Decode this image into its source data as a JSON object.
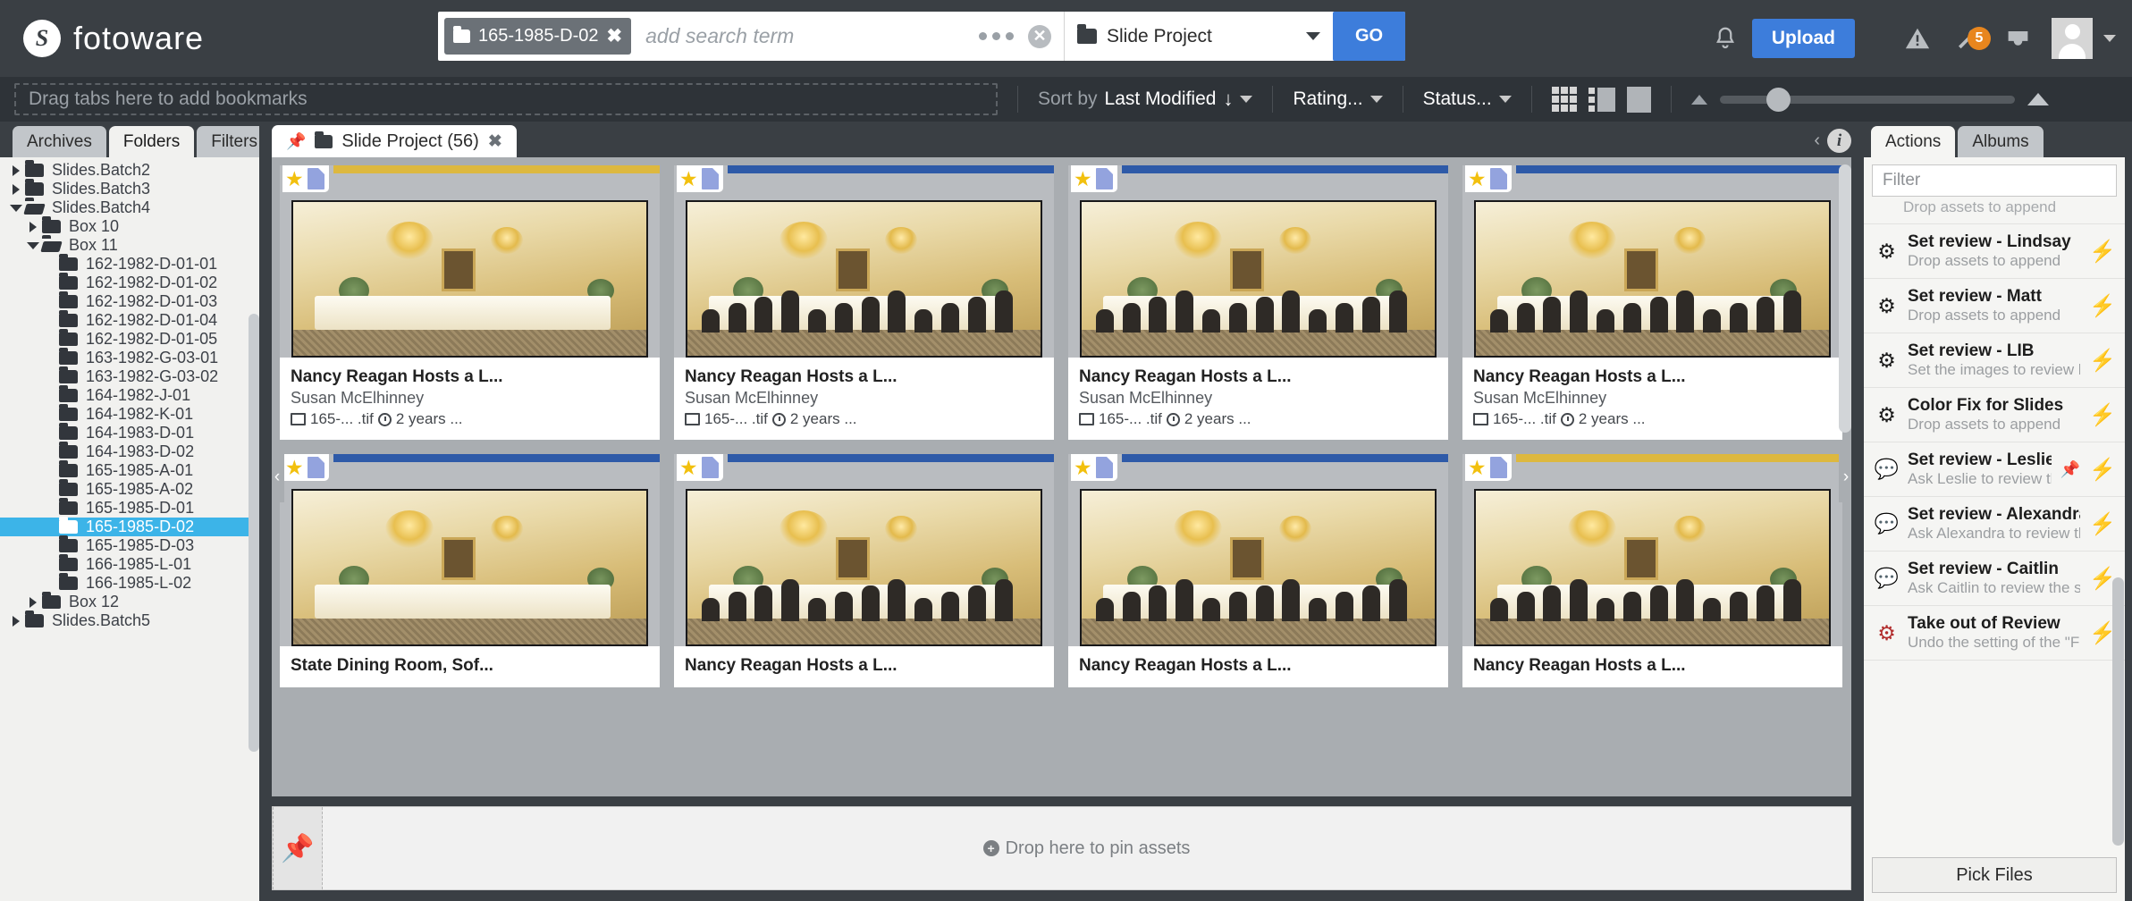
{
  "app": {
    "name": "fotoware",
    "logo_icon": "fotoware-logo-icon"
  },
  "search": {
    "chip_label": "165-1985-D-02",
    "chip_remove_icon": "close-icon",
    "placeholder": "add search term",
    "more_icon": "more-options-icon",
    "clear_icon": "clear-search-icon",
    "scope_value": "Slide Project",
    "scope_caret_icon": "chevron-down-icon",
    "go_label": "GO"
  },
  "header": {
    "bell_icon": "notifications-bell-icon",
    "upload_label": "Upload",
    "alert_icon": "warning-triangle-icon",
    "tools_icon": "wrench-icon",
    "tools_badge": "5",
    "inbox_icon": "inbox-icon",
    "avatar_icon": "user-avatar",
    "avatar_caret_icon": "chevron-down-icon"
  },
  "toolbar": {
    "bookmarks_placeholder": "Drag tabs here to add bookmarks",
    "sort_prefix": "Sort by",
    "sort_value": "Last Modified",
    "sort_direction_icon": "arrow-down-icon",
    "rating_label": "Rating...",
    "status_label": "Status...",
    "view_grid_icon": "grid-view-icon",
    "view_split_icon": "split-view-icon",
    "view_single_icon": "single-view-icon",
    "zoom_out_icon": "small-triangle-icon",
    "zoom_in_icon": "large-triangle-icon"
  },
  "left_panel": {
    "tabs": [
      {
        "label": "Archives",
        "active": false
      },
      {
        "label": "Folders",
        "active": true
      },
      {
        "label": "Filters",
        "active": false
      }
    ],
    "tree": [
      {
        "label": "Slides.Batch2",
        "indent": 0,
        "twisty": "right",
        "state": "closed",
        "selected": false
      },
      {
        "label": "Slides.Batch3",
        "indent": 0,
        "twisty": "right",
        "state": "closed",
        "selected": false
      },
      {
        "label": "Slides.Batch4",
        "indent": 0,
        "twisty": "down",
        "state": "open",
        "selected": false
      },
      {
        "label": "Box 10",
        "indent": 1,
        "twisty": "right",
        "state": "closed",
        "selected": false
      },
      {
        "label": "Box 11",
        "indent": 1,
        "twisty": "down",
        "state": "open",
        "selected": false
      },
      {
        "label": "162-1982-D-01-01",
        "indent": 2,
        "twisty": "none",
        "state": "closed",
        "selected": false
      },
      {
        "label": "162-1982-D-01-02",
        "indent": 2,
        "twisty": "none",
        "state": "closed",
        "selected": false
      },
      {
        "label": "162-1982-D-01-03",
        "indent": 2,
        "twisty": "none",
        "state": "closed",
        "selected": false
      },
      {
        "label": "162-1982-D-01-04",
        "indent": 2,
        "twisty": "none",
        "state": "closed",
        "selected": false
      },
      {
        "label": "162-1982-D-01-05",
        "indent": 2,
        "twisty": "none",
        "state": "closed",
        "selected": false
      },
      {
        "label": "163-1982-G-03-01",
        "indent": 2,
        "twisty": "none",
        "state": "closed",
        "selected": false
      },
      {
        "label": "163-1982-G-03-02",
        "indent": 2,
        "twisty": "none",
        "state": "closed",
        "selected": false
      },
      {
        "label": "164-1982-J-01",
        "indent": 2,
        "twisty": "none",
        "state": "closed",
        "selected": false
      },
      {
        "label": "164-1982-K-01",
        "indent": 2,
        "twisty": "none",
        "state": "closed",
        "selected": false
      },
      {
        "label": "164-1983-D-01",
        "indent": 2,
        "twisty": "none",
        "state": "closed",
        "selected": false
      },
      {
        "label": "164-1983-D-02",
        "indent": 2,
        "twisty": "none",
        "state": "closed",
        "selected": false
      },
      {
        "label": "165-1985-A-01",
        "indent": 2,
        "twisty": "none",
        "state": "closed",
        "selected": false
      },
      {
        "label": "165-1985-A-02",
        "indent": 2,
        "twisty": "none",
        "state": "closed",
        "selected": false
      },
      {
        "label": "165-1985-D-01",
        "indent": 2,
        "twisty": "none",
        "state": "closed",
        "selected": false
      },
      {
        "label": "165-1985-D-02",
        "indent": 2,
        "twisty": "none",
        "state": "closed",
        "selected": true
      },
      {
        "label": "165-1985-D-03",
        "indent": 2,
        "twisty": "none",
        "state": "closed",
        "selected": false
      },
      {
        "label": "166-1985-L-01",
        "indent": 2,
        "twisty": "none",
        "state": "closed",
        "selected": false
      },
      {
        "label": "166-1985-L-02",
        "indent": 2,
        "twisty": "none",
        "state": "closed",
        "selected": false
      },
      {
        "label": "Box 12",
        "indent": 1,
        "twisty": "right",
        "state": "closed",
        "selected": false
      },
      {
        "label": "Slides.Batch5",
        "indent": 0,
        "twisty": "right",
        "state": "closed",
        "selected": false
      }
    ]
  },
  "center": {
    "tab": {
      "pin_icon": "pin-icon",
      "folder_icon": "folder-icon",
      "label": "Slide Project  (56)",
      "close_icon": "close-icon"
    },
    "collapse_icon": "chevron-left-icon",
    "info_icon": "info-icon",
    "prev_icon": "previous-arrow-icon",
    "next_icon": "next-arrow-icon",
    "cards": [
      {
        "title": "Nancy Reagan Hosts a L...",
        "author": "Susan McElhinney",
        "file": "165-... .tif",
        "age": "2 years ...",
        "bar_color": "#ddb83f",
        "star_icon": "star-icon",
        "doc_icon": "document-icon"
      },
      {
        "title": "Nancy Reagan Hosts a L...",
        "author": "Susan McElhinney",
        "file": "165-... .tif",
        "age": "2 years ...",
        "bar_color": "#2e5aa8",
        "star_icon": "star-icon",
        "doc_icon": "document-icon"
      },
      {
        "title": "Nancy Reagan Hosts a L...",
        "author": "Susan McElhinney",
        "file": "165-... .tif",
        "age": "2 years ...",
        "bar_color": "#2e5aa8",
        "star_icon": "star-icon",
        "doc_icon": "document-icon"
      },
      {
        "title": "Nancy Reagan Hosts a L...",
        "author": "Susan McElhinney",
        "file": "165-... .tif",
        "age": "2 years ...",
        "bar_color": "#2e5aa8",
        "star_icon": "star-icon",
        "doc_icon": "document-icon"
      },
      {
        "title": "State Dining Room, Sof...",
        "author": "",
        "file": "",
        "age": "",
        "bar_color": "#2e5aa8",
        "star_icon": "star-icon",
        "doc_icon": "document-icon"
      },
      {
        "title": "Nancy Reagan Hosts a L...",
        "author": "",
        "file": "",
        "age": "",
        "bar_color": "#2e5aa8",
        "star_icon": "star-icon",
        "doc_icon": "document-icon"
      },
      {
        "title": "Nancy Reagan Hosts a L...",
        "author": "",
        "file": "",
        "age": "",
        "bar_color": "#2e5aa8",
        "star_icon": "star-icon",
        "doc_icon": "document-icon"
      },
      {
        "title": "Nancy Reagan Hosts a L...",
        "author": "",
        "file": "",
        "age": "",
        "bar_color": "#ddb83f",
        "star_icon": "star-icon",
        "doc_icon": "document-icon"
      }
    ],
    "dropzone": {
      "pin_icon": "pin-icon",
      "plus_icon": "plus-circle-icon",
      "label": "Drop here to pin assets"
    }
  },
  "right_panel": {
    "tabs": [
      {
        "label": "Actions",
        "active": true
      },
      {
        "label": "Albums",
        "active": false
      }
    ],
    "filter_placeholder": "Filter",
    "partial_item_sub": "Drop assets to append",
    "actions": [
      {
        "title": "Set review - Lindsay",
        "sub": "Drop assets to append",
        "icon": "gear-icon",
        "icon_color": "dark",
        "pinned": false,
        "run_icon": "lightning-bolt-icon"
      },
      {
        "title": "Set review - Matt",
        "sub": "Drop assets to append",
        "icon": "gear-icon",
        "icon_color": "dark",
        "pinned": false,
        "run_icon": "lightning-bolt-icon"
      },
      {
        "title": "Set review - LIB",
        "sub": "Set the images to review by Libra...",
        "icon": "gear-icon",
        "icon_color": "dark",
        "pinned": false,
        "run_icon": "lightning-bolt-icon"
      },
      {
        "title": "Color Fix for Slides",
        "sub": "Drop assets to append",
        "icon": "gear-icon",
        "icon_color": "dark",
        "pinned": false,
        "run_icon": "lightning-bolt-icon"
      },
      {
        "title": "Set review - Leslie",
        "sub": "Ask Leslie to review the sele...",
        "icon": "comment-icon",
        "icon_color": "red",
        "pinned": true,
        "run_icon": "lightning-bolt-icon"
      },
      {
        "title": "Set review - Alexandra",
        "sub": "Ask Alexandra to review the selec...",
        "icon": "comment-icon",
        "icon_color": "red",
        "pinned": false,
        "run_icon": "lightning-bolt-icon"
      },
      {
        "title": "Set review - Caitlin",
        "sub": "Ask Caitlin to review the selected ...",
        "icon": "comment-icon",
        "icon_color": "red",
        "pinned": false,
        "run_icon": "lightning-bolt-icon"
      },
      {
        "title": "Take out of Review",
        "sub": "Undo the setting of the \"For Revi...",
        "icon": "gear-icon",
        "icon_color": "red",
        "pinned": false,
        "run_icon": "lightning-bolt-icon"
      }
    ],
    "pick_files_label": "Pick Files"
  }
}
